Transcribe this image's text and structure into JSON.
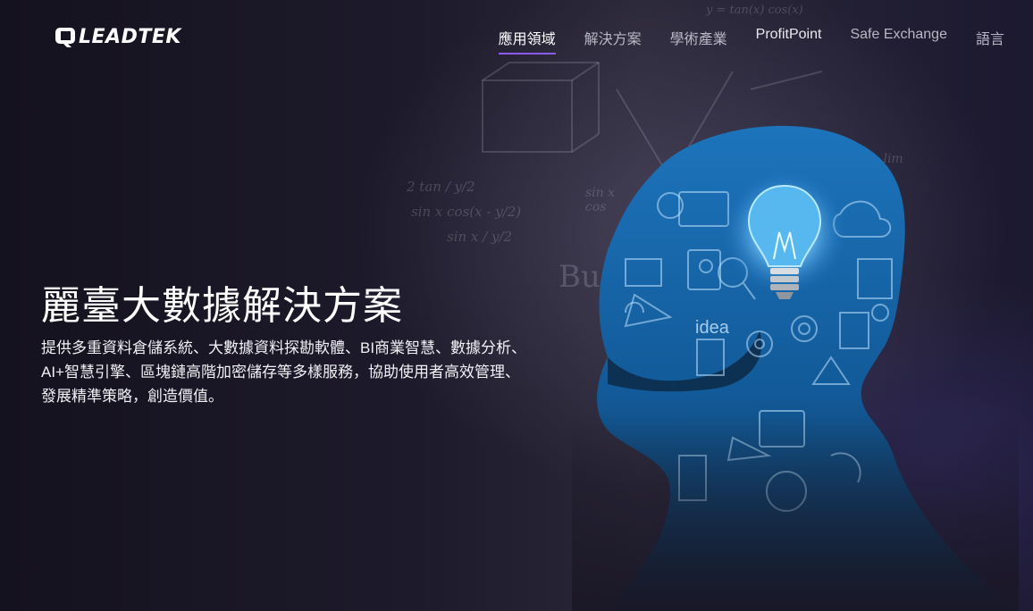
{
  "brand": {
    "logo_text": "LEADTEK",
    "logo_alt": "Leadtek"
  },
  "nav": {
    "items": [
      {
        "label": "應用領域",
        "active": true
      },
      {
        "label": "解決方案",
        "active": false
      },
      {
        "label": "學術產業",
        "active": false
      },
      {
        "label": "ProfitPoint",
        "active": false
      },
      {
        "label": "Safe Exchange",
        "active": false
      },
      {
        "label": "語言",
        "active": false
      }
    ]
  },
  "hero": {
    "title": "麗臺大數據解決方案",
    "description": "提供多重資料倉儲系統、大數據資料探勘軟體、BI商業智慧、數據分析、AI+智慧引擎、區塊鏈高階加密儲存等多樣服務，協助使用者高效管理、發展精準策略，創造價值。",
    "illustration_label": "idea"
  },
  "colors": {
    "background": "#1a1726",
    "accent_underline": "#8a5cf6",
    "head_blue": "#1a6fb5",
    "bulb_glow": "#7fd0ff"
  }
}
